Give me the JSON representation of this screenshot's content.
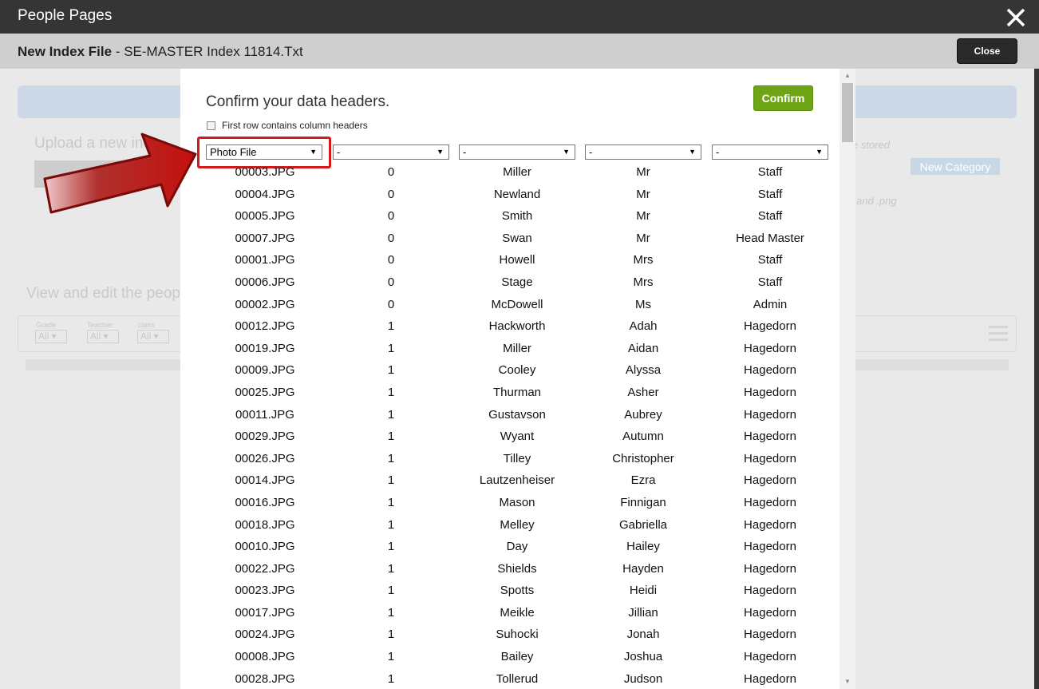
{
  "window": {
    "title": "People Pages"
  },
  "subheader": {
    "label": "New Index File",
    "file": " - SE-MASTER Index 11814.Txt",
    "close_label": "Close"
  },
  "background": {
    "upload_text": "Upload a new inc",
    "stored_text": "e stored",
    "new_category_label": "New Category",
    "png_text": "and .png",
    "view_text": "View and edit the peop",
    "filters": [
      {
        "label": "Grade",
        "value": "All ▾"
      },
      {
        "label": "Teacher",
        "value": "All ▾"
      },
      {
        "label": "class",
        "value": "All ▾"
      }
    ]
  },
  "dialog": {
    "heading": "Confirm your data headers.",
    "confirm_label": "Confirm",
    "checkbox_label": "First row contains column headers",
    "column_selects": [
      "Photo File",
      "-",
      "-",
      "-",
      "-"
    ],
    "rows": [
      [
        "00003.JPG",
        "0",
        "Miller",
        "Mr",
        "Staff"
      ],
      [
        "00004.JPG",
        "0",
        "Newland",
        "Mr",
        "Staff"
      ],
      [
        "00005.JPG",
        "0",
        "Smith",
        "Mr",
        "Staff"
      ],
      [
        "00007.JPG",
        "0",
        "Swan",
        "Mr",
        "Head Master"
      ],
      [
        "00001.JPG",
        "0",
        "Howell",
        "Mrs",
        "Staff"
      ],
      [
        "00006.JPG",
        "0",
        "Stage",
        "Mrs",
        "Staff"
      ],
      [
        "00002.JPG",
        "0",
        "McDowell",
        "Ms",
        "Admin"
      ],
      [
        "00012.JPG",
        "1",
        "Hackworth",
        "Adah",
        "Hagedorn"
      ],
      [
        "00019.JPG",
        "1",
        "Miller",
        "Aidan",
        "Hagedorn"
      ],
      [
        "00009.JPG",
        "1",
        "Cooley",
        "Alyssa",
        "Hagedorn"
      ],
      [
        "00025.JPG",
        "1",
        "Thurman",
        "Asher",
        "Hagedorn"
      ],
      [
        "00011.JPG",
        "1",
        "Gustavson",
        "Aubrey",
        "Hagedorn"
      ],
      [
        "00029.JPG",
        "1",
        "Wyant",
        "Autumn",
        "Hagedorn"
      ],
      [
        "00026.JPG",
        "1",
        "Tilley",
        "Christopher",
        "Hagedorn"
      ],
      [
        "00014.JPG",
        "1",
        "Lautzenheiser",
        "Ezra",
        "Hagedorn"
      ],
      [
        "00016.JPG",
        "1",
        "Mason",
        "Finnigan",
        "Hagedorn"
      ],
      [
        "00018.JPG",
        "1",
        "Melley",
        "Gabriella",
        "Hagedorn"
      ],
      [
        "00010.JPG",
        "1",
        "Day",
        "Hailey",
        "Hagedorn"
      ],
      [
        "00022.JPG",
        "1",
        "Shields",
        "Hayden",
        "Hagedorn"
      ],
      [
        "00023.JPG",
        "1",
        "Spotts",
        "Heidi",
        "Hagedorn"
      ],
      [
        "00017.JPG",
        "1",
        "Meikle",
        "Jillian",
        "Hagedorn"
      ],
      [
        "00024.JPG",
        "1",
        "Suhocki",
        "Jonah",
        "Hagedorn"
      ],
      [
        "00008.JPG",
        "1",
        "Bailey",
        "Joshua",
        "Hagedorn"
      ],
      [
        "00028.JPG",
        "1",
        "Tollerud",
        "Judson",
        "Hagedorn"
      ]
    ]
  },
  "icons": {
    "close": "close-x-icon",
    "callout": "red-arrow-icon",
    "select": "chevron-down-icon"
  },
  "colors": {
    "confirm": "#6ea516",
    "highlight": "#d31a1a",
    "titlebar": "#353535"
  }
}
